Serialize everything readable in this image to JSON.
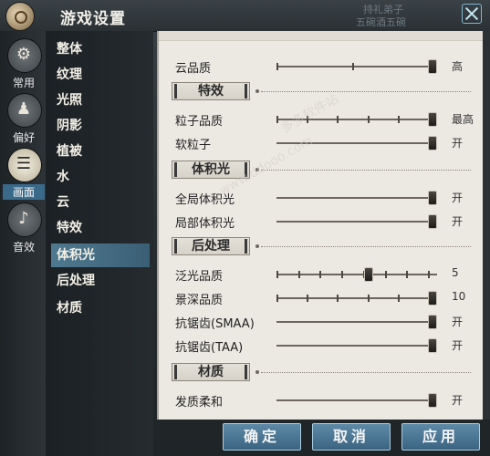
{
  "window": {
    "title": "游戏设置",
    "bg_texts": [
      "持礼弟子",
      "五碗酒五碗"
    ]
  },
  "categories": [
    {
      "label": "常用",
      "icon": "gear-icon",
      "glyph": "⚙",
      "active": false
    },
    {
      "label": "偏好",
      "icon": "person-icon",
      "glyph": "♟",
      "active": false
    },
    {
      "label": "画面",
      "icon": "display-icon",
      "glyph": "☰",
      "active": true
    },
    {
      "label": "音效",
      "icon": "audio-icon",
      "glyph": "♪",
      "active": false
    }
  ],
  "subnav": [
    {
      "label": "整体",
      "active": false
    },
    {
      "label": "纹理",
      "active": false
    },
    {
      "label": "光照",
      "active": false
    },
    {
      "label": "阴影",
      "active": false
    },
    {
      "label": "植被",
      "active": false
    },
    {
      "label": "水",
      "active": false
    },
    {
      "label": "云",
      "active": false
    },
    {
      "label": "特效",
      "active": false
    },
    {
      "label": "体积光",
      "active": true
    },
    {
      "label": "后处理",
      "active": false
    },
    {
      "label": "材质",
      "active": false
    }
  ],
  "settings": {
    "cloud_quality": {
      "label": "云品质",
      "value": "高",
      "ticks": 3,
      "position": 1.0
    },
    "effects_section": "特效",
    "particle_quality": {
      "label": "粒子品质",
      "value": "最高",
      "ticks": 6,
      "position": 1.0
    },
    "soft_particles": {
      "label": "软粒子",
      "value": "开",
      "ticks": 0,
      "position": 1.0
    },
    "volumetric_section": "体积光",
    "global_volumetric": {
      "label": "全局体积光",
      "value": "开",
      "ticks": 0,
      "position": 1.0
    },
    "local_volumetric": {
      "label": "局部体积光",
      "value": "开",
      "ticks": 0,
      "position": 1.0
    },
    "postprocess_section": "后处理",
    "bloom_quality": {
      "label": "泛光品质",
      "value": "5",
      "ticks": 8,
      "position": 0.58
    },
    "dof_quality": {
      "label": "景深品质",
      "value": "10",
      "ticks": 6,
      "position": 1.0
    },
    "smaa": {
      "label": "抗锯齿(SMAA)",
      "value": "开",
      "ticks": 0,
      "position": 1.0
    },
    "taa": {
      "label": "抗锯齿(TAA)",
      "value": "开",
      "ticks": 0,
      "position": 1.0
    },
    "material_section": "材质",
    "hair_soft": {
      "label": "发质柔和",
      "value": "开",
      "ticks": 0,
      "position": 1.0
    }
  },
  "buttons": {
    "confirm": "确定",
    "cancel": "取消",
    "apply": "应用"
  },
  "watermarks": [
    "www.ddooo.com",
    "多多软件站"
  ],
  "colors": {
    "accent": "#3b6481",
    "panel": "#ece9e3"
  }
}
